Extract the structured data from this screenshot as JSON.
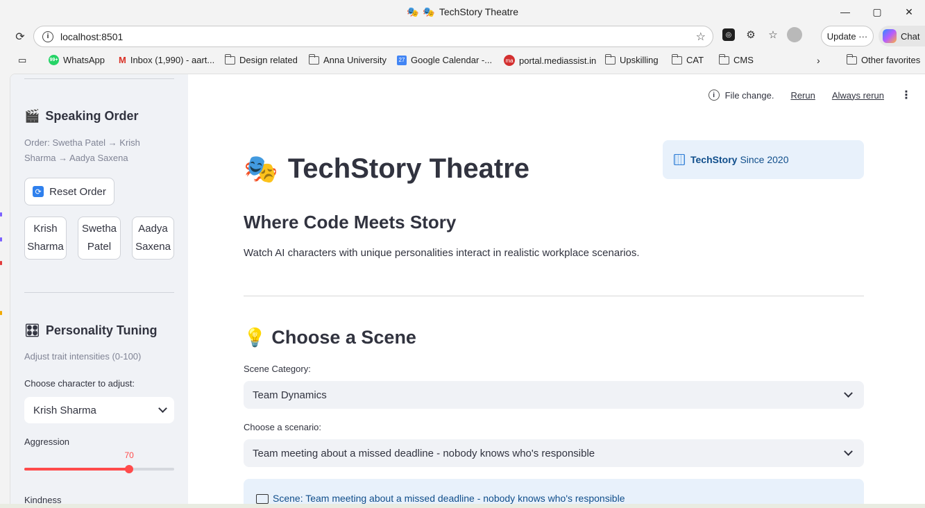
{
  "window": {
    "title": "TechStory Theatre",
    "title_emoji": "🎭",
    "controls": {
      "minimize": "—",
      "maximize": "▢",
      "close": "✕"
    }
  },
  "browser": {
    "url": "localhost:8501",
    "update_label": "Update",
    "update_more": "···",
    "chat_label": "Chat",
    "bookmarks": [
      {
        "label": "WhatsApp",
        "icon": "whatsapp-icon",
        "badge": "99+"
      },
      {
        "label": "Inbox (1,990) - aart...",
        "icon": "gmail-icon"
      },
      {
        "label": "Design related",
        "icon": "folder-icon"
      },
      {
        "label": "Anna University",
        "icon": "folder-icon"
      },
      {
        "label": "Google Calendar -...",
        "icon": "calendar-icon",
        "badge": "27"
      },
      {
        "label": "portal.mediassist.in",
        "icon": "mediassist-icon"
      },
      {
        "label": "Upskilling",
        "icon": "folder-icon"
      },
      {
        "label": "CAT",
        "icon": "folder-icon"
      },
      {
        "label": "CMS",
        "icon": "folder-icon"
      }
    ],
    "other_favorites": "Other favorites"
  },
  "sidebar": {
    "speaking_order": {
      "heading": "Speaking Order",
      "heading_icon": "🎬",
      "order_text": "Order: Swetha Patel → Krish Sharma → Aadya Saxena",
      "reset_label": "Reset Order",
      "reset_icon": "🔄",
      "characters": [
        {
          "line1": "Krish",
          "line2": "Sharma"
        },
        {
          "line1": "Swetha",
          "line2": "Patel"
        },
        {
          "line1": "Aadya",
          "line2": "Saxena"
        }
      ]
    },
    "personality": {
      "heading": "Personality Tuning",
      "heading_icon": "🎛",
      "caption": "Adjust trait intensities (0-100)",
      "choose_label": "Choose character to adjust:",
      "selected_character": "Krish Sharma",
      "aggression_label": "Aggression",
      "aggression_value": 70,
      "aggression_max": 100,
      "kindness_label": "Kindness"
    }
  },
  "main": {
    "toolbar": {
      "file_change": "File change.",
      "rerun": "Rerun",
      "always_rerun": "Always rerun"
    },
    "badge": {
      "bold": "TechStory",
      "rest": "Since 2020"
    },
    "title": "TechStory Theatre",
    "title_emoji": "🎭",
    "subtitle": "Where Code Meets Story",
    "description": "Watch AI characters with unique personalities interact in realistic workplace scenarios.",
    "choose_scene": {
      "heading": "Choose a Scene",
      "heading_icon": "💡",
      "category_label": "Scene Category:",
      "category_value": "Team Dynamics",
      "scenario_label": "Choose a scenario:",
      "scenario_value": "Team meeting about a missed deadline - nobody knows who's responsible",
      "scene_text": "Scene: Team meeting about a missed deadline - nobody knows who's responsible"
    }
  },
  "colors": {
    "accent": "#ff4b4b",
    "sidebar_bg": "#f0f2f6",
    "info_bg": "#e8f1fb",
    "info_text": "#104e8b"
  }
}
